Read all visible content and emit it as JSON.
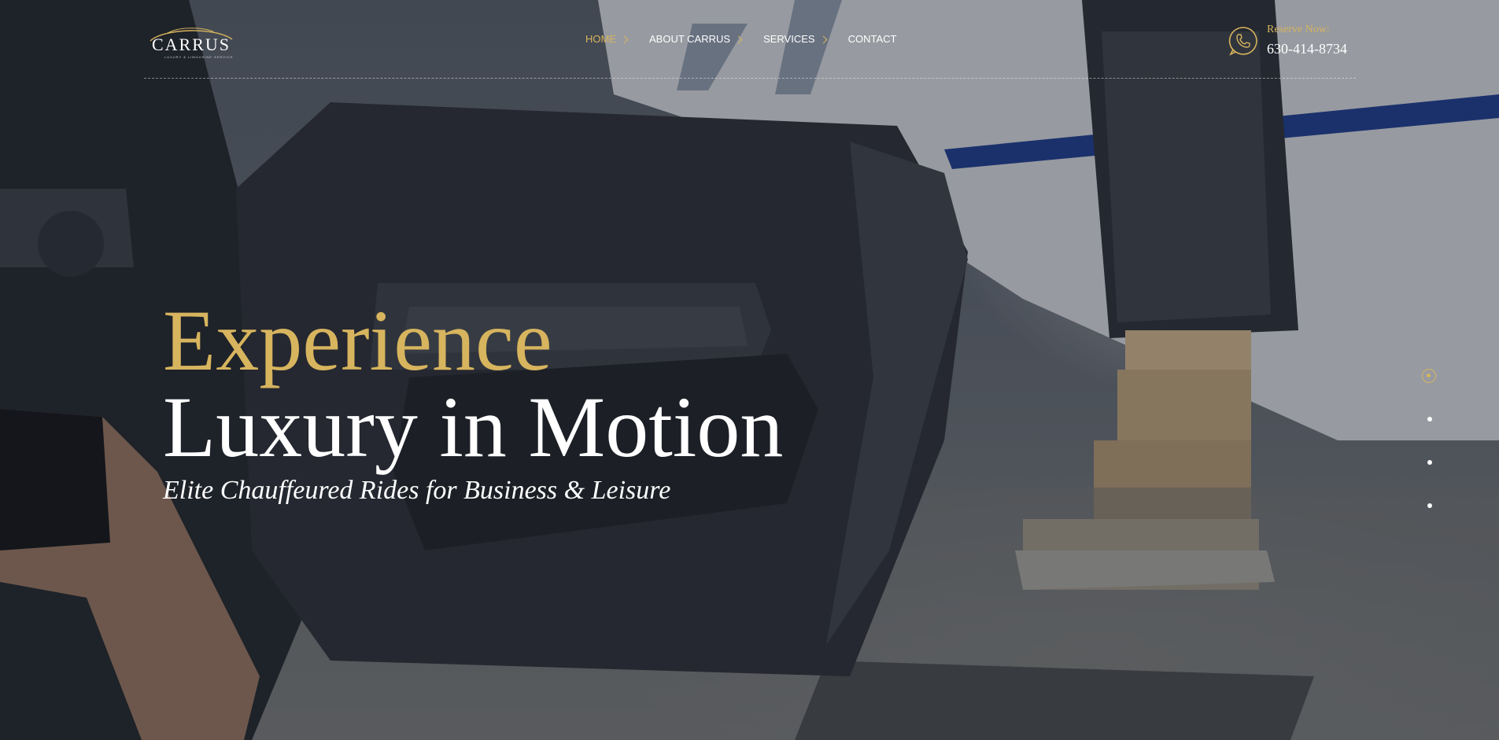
{
  "brand": {
    "name": "CARRUS",
    "tagline": "LUXURY & LIMOUSINE SERVICE"
  },
  "nav": [
    {
      "label": "HOME",
      "active": true,
      "has_dropdown": true
    },
    {
      "label": "ABOUT CARRUS",
      "active": false,
      "has_dropdown": true
    },
    {
      "label": "SERVICES",
      "active": false,
      "has_dropdown": true
    },
    {
      "label": "CONTACT",
      "active": false,
      "has_dropdown": false
    }
  ],
  "reserve": {
    "label": "Reserve Now:",
    "phone": "630-414-8734",
    "icon": "phone-icon"
  },
  "hero": {
    "headline_accent": "Experience",
    "headline_main": "Luxury in Motion",
    "subheadline": "Elite Chauffeured Rides for Business & Leisure"
  },
  "slider": {
    "total_slides": 4,
    "active_index": 0
  },
  "colors": {
    "accent": "#d7b45e",
    "text": "#ffffff",
    "overlay": "#161a22"
  }
}
